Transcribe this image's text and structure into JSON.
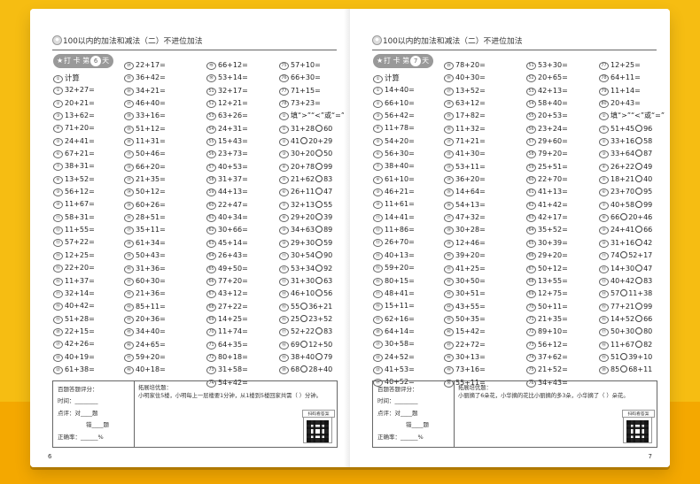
{
  "left": {
    "header": "100以内的加法和减法（二）不进位加法",
    "checkin": {
      "prefix": "打 卡 第",
      "day": "6",
      "suffix": "天"
    },
    "section": "计算",
    "columns": [
      [
        {
          "i": "①",
          "t": "32+27="
        },
        {
          "i": "②",
          "t": "20+21="
        },
        {
          "i": "③",
          "t": "13+62="
        },
        {
          "i": "④",
          "t": "71+20="
        },
        {
          "i": "⑤",
          "t": "24+41="
        },
        {
          "i": "⑥",
          "t": "67+21="
        },
        {
          "i": "⑦",
          "t": "38+31="
        },
        {
          "i": "⑧",
          "t": "13+52="
        },
        {
          "i": "⑨",
          "t": "56+12="
        },
        {
          "i": "⑩",
          "t": "11+67="
        },
        {
          "i": "⑪",
          "t": "58+31="
        },
        {
          "i": "⑫",
          "t": "11+55="
        },
        {
          "i": "⑬",
          "t": "57+22="
        },
        {
          "i": "⑭",
          "t": "12+25="
        },
        {
          "i": "⑮",
          "t": "22+20="
        },
        {
          "i": "⑯",
          "t": "11+37="
        },
        {
          "i": "⑰",
          "t": "32+14="
        },
        {
          "i": "⑱",
          "t": "40+42="
        },
        {
          "i": "⑲",
          "t": "51+28="
        },
        {
          "i": "⑳",
          "t": "22+15="
        },
        {
          "i": "㉑",
          "t": "42+26="
        },
        {
          "i": "㉒",
          "t": "40+19="
        },
        {
          "i": "㉓",
          "t": "61+38="
        }
      ],
      [
        {
          "i": "㉔",
          "t": "22+17="
        },
        {
          "i": "㉕",
          "t": "36+42="
        },
        {
          "i": "㉖",
          "t": "34+21="
        },
        {
          "i": "㉗",
          "t": "46+40="
        },
        {
          "i": "㉘",
          "t": "33+16="
        },
        {
          "i": "㉙",
          "t": "51+12="
        },
        {
          "i": "㉚",
          "t": "11+31="
        },
        {
          "i": "㉛",
          "t": "50+46="
        },
        {
          "i": "㉜",
          "t": "66+20="
        },
        {
          "i": "㉝",
          "t": "21+35="
        },
        {
          "i": "㉞",
          "t": "50+12="
        },
        {
          "i": "㉟",
          "t": "60+26="
        },
        {
          "i": "㊱",
          "t": "28+51="
        },
        {
          "i": "㊲",
          "t": "35+11="
        },
        {
          "i": "㊳",
          "t": "61+34="
        },
        {
          "i": "㊴",
          "t": "50+43="
        },
        {
          "i": "㊵",
          "t": "31+36="
        },
        {
          "i": "㊶",
          "t": "60+30="
        },
        {
          "i": "㊷",
          "t": "21+36="
        },
        {
          "i": "㊸",
          "t": "85+11="
        },
        {
          "i": "㊹",
          "t": "20+36="
        },
        {
          "i": "㊺",
          "t": "34+40="
        },
        {
          "i": "㊻",
          "t": "24+65="
        },
        {
          "i": "㊼",
          "t": "59+20="
        },
        {
          "i": "㊽",
          "t": "40+18="
        }
      ],
      [
        {
          "i": "㊾",
          "t": "66+12="
        },
        {
          "i": "㊿",
          "t": "53+14="
        },
        {
          "i": "51",
          "t": "32+17="
        },
        {
          "i": "52",
          "t": "12+21="
        },
        {
          "i": "53",
          "t": "63+26="
        },
        {
          "i": "54",
          "t": "24+31="
        },
        {
          "i": "55",
          "t": "15+43="
        },
        {
          "i": "56",
          "t": "23+73="
        },
        {
          "i": "57",
          "t": "40+53="
        },
        {
          "i": "58",
          "t": "31+37="
        },
        {
          "i": "59",
          "t": "44+13="
        },
        {
          "i": "60",
          "t": "22+47="
        },
        {
          "i": "61",
          "t": "40+34="
        },
        {
          "i": "62",
          "t": "30+66="
        },
        {
          "i": "63",
          "t": "45+14="
        },
        {
          "i": "64",
          "t": "26+43="
        },
        {
          "i": "65",
          "t": "49+50="
        },
        {
          "i": "66",
          "t": "77+20="
        },
        {
          "i": "67",
          "t": "43+12="
        },
        {
          "i": "68",
          "t": "27+22="
        },
        {
          "i": "69",
          "t": "14+25="
        },
        {
          "i": "70",
          "t": "11+74="
        },
        {
          "i": "71",
          "t": "64+35="
        },
        {
          "i": "72",
          "t": "80+18="
        },
        {
          "i": "73",
          "t": "31+58="
        },
        {
          "i": "74",
          "t": "54+42="
        }
      ],
      [
        {
          "i": "75",
          "t": "57+10="
        },
        {
          "i": "76",
          "t": "66+30="
        },
        {
          "i": "77",
          "t": "71+15="
        },
        {
          "i": "78",
          "t": "73+23="
        },
        {
          "i": "②",
          "t": "填“>”“<”或“=”"
        },
        {
          "i": "①",
          "a": "31+28",
          "b": "60"
        },
        {
          "i": "②",
          "a": "41",
          "b": "20+29"
        },
        {
          "i": "③",
          "a": "30+20",
          "b": "50"
        },
        {
          "i": "④",
          "a": "20+78",
          "b": "99"
        },
        {
          "i": "⑤",
          "a": "21+62",
          "b": "83"
        },
        {
          "i": "⑥",
          "a": "26+11",
          "b": "47"
        },
        {
          "i": "⑦",
          "a": "32+13",
          "b": "55"
        },
        {
          "i": "⑧",
          "a": "29+20",
          "b": "39"
        },
        {
          "i": "⑨",
          "a": "34+63",
          "b": "89"
        },
        {
          "i": "⑩",
          "a": "29+30",
          "b": "59"
        },
        {
          "i": "⑪",
          "a": "30+54",
          "b": "90"
        },
        {
          "i": "⑫",
          "a": "53+34",
          "b": "92"
        },
        {
          "i": "⑬",
          "a": "31+30",
          "b": "63"
        },
        {
          "i": "⑭",
          "a": "46+10",
          "b": "56"
        },
        {
          "i": "⑮",
          "a": "55",
          "b": "36+21"
        },
        {
          "i": "⑯",
          "a": "25",
          "b": "23+52"
        },
        {
          "i": "⑰",
          "a": "52+22",
          "b": "83"
        },
        {
          "i": "⑱",
          "a": "69",
          "b": "12+50"
        },
        {
          "i": "⑲",
          "a": "38+40",
          "b": "79"
        },
        {
          "i": "⑳",
          "a": "68",
          "b": "28+40"
        }
      ]
    ],
    "score": {
      "title": "百题答题评分：",
      "time": "时间：________",
      "right": "点评：对____题",
      "wrong": "错____题",
      "rate": "正确率：______%"
    },
    "extend": {
      "title": "拓展培优题：",
      "text": "小明家住5楼，小明每上一层楼要1分钟，从1楼到5楼回家共需（ ）分钟。"
    },
    "qr_label": "扫码看答案",
    "page_number": "6"
  },
  "right": {
    "header": "100以内的加法和减法（二）不进位加法",
    "checkin": {
      "prefix": "打 卡 第",
      "day": "7",
      "suffix": "天"
    },
    "section": "计算",
    "columns": [
      [
        {
          "i": "①",
          "t": "14+40="
        },
        {
          "i": "②",
          "t": "66+10="
        },
        {
          "i": "③",
          "t": "56+42="
        },
        {
          "i": "④",
          "t": "11+78="
        },
        {
          "i": "⑤",
          "t": "54+20="
        },
        {
          "i": "⑥",
          "t": "56+30="
        },
        {
          "i": "⑦",
          "t": "38+40="
        },
        {
          "i": "⑧",
          "t": "61+10="
        },
        {
          "i": "⑨",
          "t": "46+21="
        },
        {
          "i": "⑩",
          "t": "11+61="
        },
        {
          "i": "⑪",
          "t": "14+41="
        },
        {
          "i": "⑫",
          "t": "11+86="
        },
        {
          "i": "⑬",
          "t": "26+70="
        },
        {
          "i": "⑭",
          "t": "40+13="
        },
        {
          "i": "⑮",
          "t": "59+20="
        },
        {
          "i": "⑯",
          "t": "80+15="
        },
        {
          "i": "⑰",
          "t": "48+41="
        },
        {
          "i": "⑱",
          "t": "15+11="
        },
        {
          "i": "⑲",
          "t": "62+16="
        },
        {
          "i": "⑳",
          "t": "64+14="
        },
        {
          "i": "㉑",
          "t": "30+58="
        },
        {
          "i": "㉒",
          "t": "24+52="
        },
        {
          "i": "㉓",
          "t": "41+53="
        },
        {
          "i": "㉔",
          "t": "40+52="
        }
      ],
      [
        {
          "i": "㉕",
          "t": "78+20="
        },
        {
          "i": "㉖",
          "t": "40+30="
        },
        {
          "i": "㉗",
          "t": "13+52="
        },
        {
          "i": "㉘",
          "t": "63+12="
        },
        {
          "i": "㉙",
          "t": "17+82="
        },
        {
          "i": "㉚",
          "t": "11+32="
        },
        {
          "i": "㉛",
          "t": "71+21="
        },
        {
          "i": "㉜",
          "t": "41+30="
        },
        {
          "i": "㉝",
          "t": "53+11="
        },
        {
          "i": "㉞",
          "t": "36+20="
        },
        {
          "i": "㉟",
          "t": "14+64="
        },
        {
          "i": "㊱",
          "t": "54+13="
        },
        {
          "i": "㊲",
          "t": "47+32="
        },
        {
          "i": "㊳",
          "t": "30+28="
        },
        {
          "i": "㊴",
          "t": "12+46="
        },
        {
          "i": "㊵",
          "t": "39+20="
        },
        {
          "i": "㊶",
          "t": "41+25="
        },
        {
          "i": "㊷",
          "t": "30+50="
        },
        {
          "i": "㊸",
          "t": "30+51="
        },
        {
          "i": "㊹",
          "t": "43+55="
        },
        {
          "i": "㊺",
          "t": "50+35="
        },
        {
          "i": "㊻",
          "t": "15+42="
        },
        {
          "i": "㊼",
          "t": "22+72="
        },
        {
          "i": "㊽",
          "t": "30+13="
        },
        {
          "i": "㊾",
          "t": "73+16="
        },
        {
          "i": "㊿",
          "t": "55+11="
        }
      ],
      [
        {
          "i": "51",
          "t": "53+30="
        },
        {
          "i": "52",
          "t": "20+65="
        },
        {
          "i": "53",
          "t": "42+13="
        },
        {
          "i": "54",
          "t": "58+40="
        },
        {
          "i": "55",
          "t": "20+53="
        },
        {
          "i": "56",
          "t": "23+24="
        },
        {
          "i": "57",
          "t": "29+60="
        },
        {
          "i": "58",
          "t": "79+20="
        },
        {
          "i": "59",
          "t": "25+51="
        },
        {
          "i": "60",
          "t": "22+70="
        },
        {
          "i": "61",
          "t": "41+13="
        },
        {
          "i": "62",
          "t": "41+42="
        },
        {
          "i": "63",
          "t": "42+17="
        },
        {
          "i": "64",
          "t": "35+52="
        },
        {
          "i": "65",
          "t": "30+39="
        },
        {
          "i": "66",
          "t": "29+20="
        },
        {
          "i": "67",
          "t": "50+12="
        },
        {
          "i": "68",
          "t": "13+55="
        },
        {
          "i": "69",
          "t": "12+75="
        },
        {
          "i": "70",
          "t": "50+11="
        },
        {
          "i": "71",
          "t": "21+35="
        },
        {
          "i": "72",
          "t": "89+10="
        },
        {
          "i": "73",
          "t": "56+12="
        },
        {
          "i": "74",
          "t": "37+62="
        },
        {
          "i": "75",
          "t": "21+52="
        },
        {
          "i": "76",
          "t": "34+43="
        }
      ],
      [
        {
          "i": "77",
          "t": "12+25="
        },
        {
          "i": "78",
          "t": "64+11="
        },
        {
          "i": "79",
          "t": "11+14="
        },
        {
          "i": "80",
          "t": "20+43="
        },
        {
          "i": "②",
          "t": "填“>”“<”或“=”"
        },
        {
          "i": "①",
          "a": "51+45",
          "b": "96"
        },
        {
          "i": "②",
          "a": "33+16",
          "b": "58"
        },
        {
          "i": "③",
          "a": "33+64",
          "b": "87"
        },
        {
          "i": "④",
          "a": "26+22",
          "b": "49"
        },
        {
          "i": "⑤",
          "a": "18+21",
          "b": "40"
        },
        {
          "i": "⑥",
          "a": "23+70",
          "b": "95"
        },
        {
          "i": "⑦",
          "a": "40+58",
          "b": "99"
        },
        {
          "i": "⑧",
          "a": "66",
          "b": "20+46"
        },
        {
          "i": "⑨",
          "a": "24+41",
          "b": "66"
        },
        {
          "i": "⑩",
          "a": "31+16",
          "b": "42"
        },
        {
          "i": "⑪",
          "a": "74",
          "b": "52+17"
        },
        {
          "i": "⑫",
          "a": "14+30",
          "b": "47"
        },
        {
          "i": "⑬",
          "a": "40+42",
          "b": "83"
        },
        {
          "i": "⑭",
          "a": "57",
          "b": "11+38"
        },
        {
          "i": "⑮",
          "a": "77+21",
          "b": "99"
        },
        {
          "i": "⑯",
          "a": "14+52",
          "b": "66"
        },
        {
          "i": "⑰",
          "a": "50+30",
          "b": "80"
        },
        {
          "i": "⑱",
          "a": "11+67",
          "b": "82"
        },
        {
          "i": "⑲",
          "a": "51",
          "b": "39+10"
        },
        {
          "i": "⑳",
          "a": "85",
          "b": "68+11"
        }
      ]
    ],
    "score": {
      "title": "百题答题评分：",
      "time": "时间：________",
      "right": "点评：对____题",
      "wrong": "错____题",
      "rate": "正确率：______%"
    },
    "extend": {
      "title": "拓展培优题：",
      "text": "小丽摘了6朵花，小华摘的花比小丽摘的多3朵，小华摘了（ ）朵花。"
    },
    "qr_label": "扫码看答案",
    "page_number": "7"
  }
}
